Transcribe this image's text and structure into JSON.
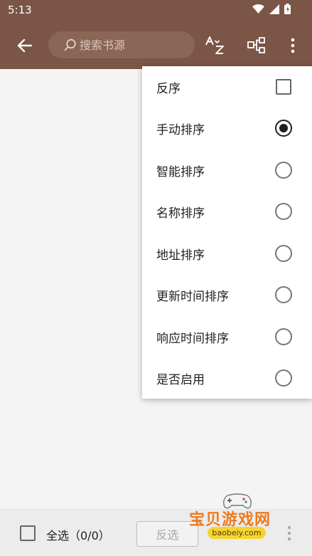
{
  "status_bar": {
    "time": "5:13"
  },
  "search": {
    "placeholder": "搜索书源"
  },
  "toolbar": {
    "back_icon": "arrow-left-icon",
    "sort_icon": "sort-az-icon",
    "group_icon": "group-tree-icon",
    "more_icon": "more-vert-icon"
  },
  "menu": {
    "items": [
      {
        "label": "反序",
        "control": "checkbox",
        "checked": false
      },
      {
        "label": "手动排序",
        "control": "radio",
        "checked": true
      },
      {
        "label": "智能排序",
        "control": "radio",
        "checked": false
      },
      {
        "label": "名称排序",
        "control": "radio",
        "checked": false
      },
      {
        "label": "地址排序",
        "control": "radio",
        "checked": false
      },
      {
        "label": "更新时间排序",
        "control": "radio",
        "checked": false
      },
      {
        "label": "响应时间排序",
        "control": "radio",
        "checked": false
      },
      {
        "label": "是否启用",
        "control": "radio",
        "checked": false
      }
    ]
  },
  "bottom_bar": {
    "select_all_label": "全选（0/0）",
    "invert_label": "反选"
  },
  "watermark": {
    "title": "宝贝游戏网",
    "url": "baobeiy.com"
  },
  "colors": {
    "appbar": "#7b5546",
    "search_bg": "#8a6656",
    "background": "#f4f4f4"
  }
}
